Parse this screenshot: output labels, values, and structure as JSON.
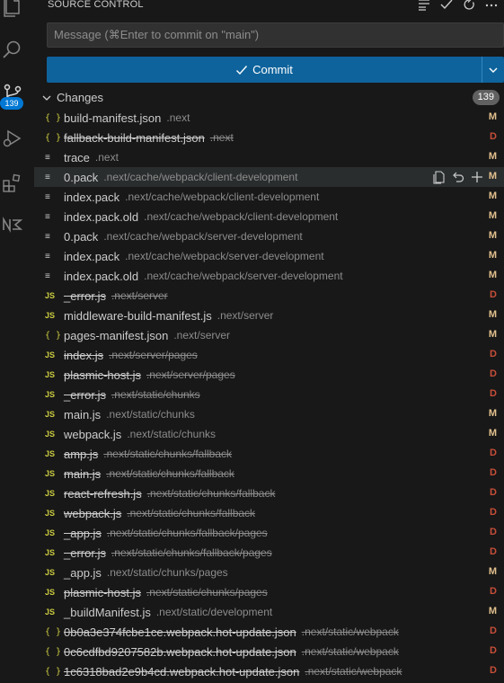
{
  "activity_bar": {
    "icons": [
      "explorer-icon",
      "search-icon",
      "source-control-icon",
      "run-debug-icon",
      "extensions-icon",
      "npm-icon"
    ],
    "badge": "139"
  },
  "panel": {
    "title": "SOURCE CONTROL",
    "header_actions": [
      "view-as-tree-icon",
      "commit-check-icon",
      "refresh-icon",
      "more-actions-icon"
    ],
    "message_placeholder": "Message (⌘Enter to commit on \"main\")",
    "commit_label": "Commit",
    "changes_label": "Changes",
    "changes_count": "139"
  },
  "colors": {
    "accent": "#0e639c",
    "modified": "#e2c08d",
    "deleted": "#c74e39",
    "badge": "#0078d4"
  },
  "files": [
    {
      "icon": "{ }",
      "type": "json",
      "name": "build-manifest.json",
      "path": ".next",
      "status": "M"
    },
    {
      "icon": "{ }",
      "type": "json",
      "name": "fallback-build-manifest.json",
      "path": ".next",
      "status": "D"
    },
    {
      "icon": "≡",
      "type": "lines",
      "name": "trace",
      "path": ".next",
      "status": "M"
    },
    {
      "icon": "≡",
      "type": "lines",
      "name": "0.pack",
      "path": ".next/cache/webpack/client-development",
      "status": "M",
      "hover": true
    },
    {
      "icon": "≡",
      "type": "lines",
      "name": "index.pack",
      "path": ".next/cache/webpack/client-development",
      "status": "M"
    },
    {
      "icon": "≡",
      "type": "lines",
      "name": "index.pack.old",
      "path": ".next/cache/webpack/client-development",
      "status": "M"
    },
    {
      "icon": "≡",
      "type": "lines",
      "name": "0.pack",
      "path": ".next/cache/webpack/server-development",
      "status": "M"
    },
    {
      "icon": "≡",
      "type": "lines",
      "name": "index.pack",
      "path": ".next/cache/webpack/server-development",
      "status": "M"
    },
    {
      "icon": "≡",
      "type": "lines",
      "name": "index.pack.old",
      "path": ".next/cache/webpack/server-development",
      "status": "M"
    },
    {
      "icon": "JS",
      "type": "js",
      "name": "_error.js",
      "path": ".next/server",
      "status": "D"
    },
    {
      "icon": "JS",
      "type": "js",
      "name": "middleware-build-manifest.js",
      "path": ".next/server",
      "status": "M"
    },
    {
      "icon": "{ }",
      "type": "json",
      "name": "pages-manifest.json",
      "path": ".next/server",
      "status": "M"
    },
    {
      "icon": "JS",
      "type": "js",
      "name": "index.js",
      "path": ".next/server/pages",
      "status": "D"
    },
    {
      "icon": "JS",
      "type": "js",
      "name": "plasmic-host.js",
      "path": ".next/server/pages",
      "status": "D"
    },
    {
      "icon": "JS",
      "type": "js",
      "name": "_error.js",
      "path": ".next/static/chunks",
      "status": "D"
    },
    {
      "icon": "JS",
      "type": "js",
      "name": "main.js",
      "path": ".next/static/chunks",
      "status": "M"
    },
    {
      "icon": "JS",
      "type": "js",
      "name": "webpack.js",
      "path": ".next/static/chunks",
      "status": "M"
    },
    {
      "icon": "JS",
      "type": "js",
      "name": "amp.js",
      "path": ".next/static/chunks/fallback",
      "status": "D"
    },
    {
      "icon": "JS",
      "type": "js",
      "name": "main.js",
      "path": ".next/static/chunks/fallback",
      "status": "D"
    },
    {
      "icon": "JS",
      "type": "js",
      "name": "react-refresh.js",
      "path": ".next/static/chunks/fallback",
      "status": "D"
    },
    {
      "icon": "JS",
      "type": "js",
      "name": "webpack.js",
      "path": ".next/static/chunks/fallback",
      "status": "D"
    },
    {
      "icon": "JS",
      "type": "js",
      "name": "_app.js",
      "path": ".next/static/chunks/fallback/pages",
      "status": "D"
    },
    {
      "icon": "JS",
      "type": "js",
      "name": "_error.js",
      "path": ".next/static/chunks/fallback/pages",
      "status": "D"
    },
    {
      "icon": "JS",
      "type": "js",
      "name": "_app.js",
      "path": ".next/static/chunks/pages",
      "status": "M"
    },
    {
      "icon": "JS",
      "type": "js",
      "name": "plasmic-host.js",
      "path": ".next/static/chunks/pages",
      "status": "D"
    },
    {
      "icon": "JS",
      "type": "js",
      "name": "_buildManifest.js",
      "path": ".next/static/development",
      "status": "M"
    },
    {
      "icon": "{ }",
      "type": "json",
      "name": "0b0a3e374fcbe1ce.webpack.hot-update.json",
      "path": ".next/static/webpack",
      "status": "D"
    },
    {
      "icon": "{ }",
      "type": "json",
      "name": "0c6cdfbd9207582b.webpack.hot-update.json",
      "path": ".next/static/webpack",
      "status": "D"
    },
    {
      "icon": "{ }",
      "type": "json",
      "name": "1c6318bad2e9b4cd.webpack.hot-update.json",
      "path": ".next/static/webpack",
      "status": "D"
    }
  ]
}
